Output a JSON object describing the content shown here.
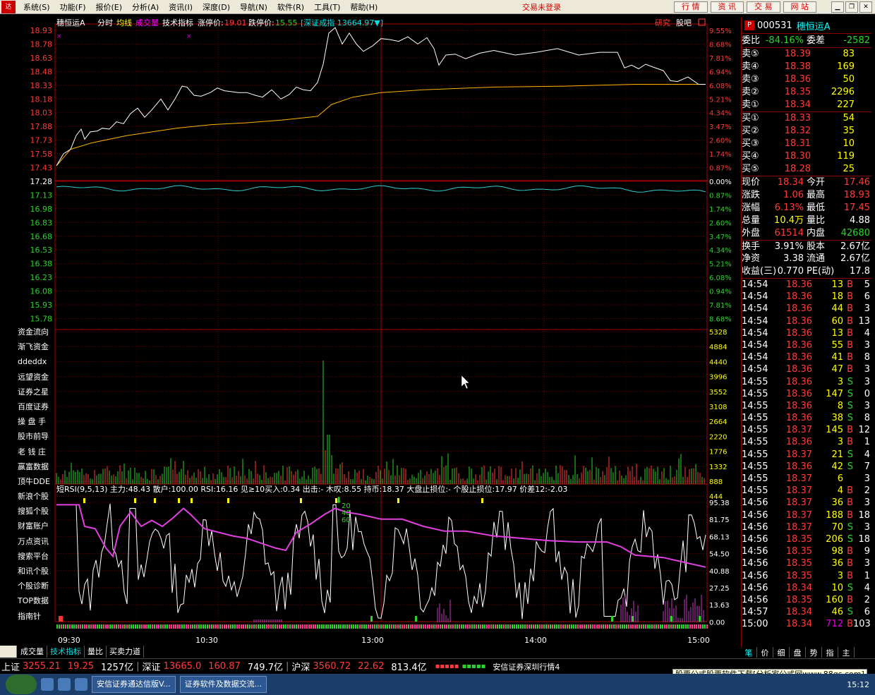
{
  "menubar": {
    "items": [
      "系统(S)",
      "功能(F)",
      "报价(E)",
      "分析(A)",
      "资讯(I)",
      "深度(D)",
      "导航(N)",
      "软件(R)",
      "工具(T)",
      "帮助(H)"
    ],
    "trade_status": "交易未登录",
    "tabs": [
      "行 情",
      "资 讯",
      "交 易",
      "网 站"
    ]
  },
  "chart_header": {
    "stock_name": "穗恒运A",
    "modes": [
      "分时",
      "均线",
      "成交量",
      "技术指标"
    ],
    "limit_up_label": "涨停价:",
    "limit_up": "19.01",
    "limit_down_label": "跌停价:",
    "limit_down": "15.55",
    "index_link": "[深证成指 13664.97▼]",
    "research": "研究",
    "forum": "股吧"
  },
  "price_axis": {
    "left": [
      "18.93",
      "18.78",
      "18.63",
      "18.48",
      "18.33",
      "18.18",
      "18.03",
      "17.88",
      "17.73",
      "17.58",
      "17.43",
      "17.28",
      "17.13",
      "16.98",
      "16.83",
      "16.68",
      "16.53",
      "16.38",
      "16.23",
      "16.08",
      "15.93",
      "15.78"
    ],
    "right": [
      "9.55%",
      "8.68%",
      "7.81%",
      "6.94%",
      "6.08%",
      "5.21%",
      "4.34%",
      "3.47%",
      "2.60%",
      "1.74%",
      "0.87%",
      "0.00%",
      "0.87%",
      "1.74%",
      "2.60%",
      "3.47%",
      "4.34%",
      "5.21%",
      "6.08%",
      "0.94%",
      "7.81%",
      "8.68%"
    ]
  },
  "volume_axis": [
    "5328",
    "4884",
    "4440",
    "3996",
    "3552",
    "3108",
    "2664",
    "2220",
    "1776",
    "1332",
    "888",
    "444"
  ],
  "indicator": {
    "legend": "短RSI(9,5,13)  主力:48.43  散户:100.00  RSI:16.16  见≥10买入:0.34  出击:-  木叹:8.55  持币:18.37  大盘止损位:-  个股止损位:17.97  价差12:-2.03",
    "axis": [
      "95.38",
      "81.75",
      "68.13",
      "54.50",
      "40.88",
      "27.25",
      "13.63",
      "0.00"
    ],
    "marks": [
      "20",
      "40",
      "60"
    ]
  },
  "time_axis": [
    "09:30",
    "10:30",
    "13:00",
    "14:00",
    "15:00"
  ],
  "sidenav": [
    "资金流向",
    "渐飞资金",
    "ddeddx",
    "远望资金",
    "证券之星",
    "百度证券",
    "操 盘 手",
    "股市前导",
    "老 钱 庄",
    "赢富数据",
    "顶牛DDE",
    "新浪个股",
    "搜狐个股",
    "财富账户",
    "万点资讯",
    "搜索平台",
    "和讯个股",
    "个股诊断",
    "TOP数据",
    "指南针"
  ],
  "bottom_tabs": [
    "成交量",
    "技术指标",
    "量比",
    "买卖力道"
  ],
  "quote": {
    "code": "000531",
    "name": "穗恒运A",
    "ratio_label": "委比",
    "ratio": "-84.16%",
    "diff_label": "委差",
    "diff": "-2582",
    "sell": [
      {
        "label": "卖⑤",
        "price": "18.39",
        "vol": "83"
      },
      {
        "label": "卖④",
        "price": "18.38",
        "vol": "169"
      },
      {
        "label": "卖③",
        "price": "18.36",
        "vol": "50"
      },
      {
        "label": "卖②",
        "price": "18.35",
        "vol": "2296"
      },
      {
        "label": "卖①",
        "price": "18.34",
        "vol": "227"
      }
    ],
    "buy": [
      {
        "label": "买①",
        "price": "18.33",
        "vol": "54"
      },
      {
        "label": "买②",
        "price": "18.32",
        "vol": "35"
      },
      {
        "label": "买③",
        "price": "18.31",
        "vol": "10"
      },
      {
        "label": "买④",
        "price": "18.30",
        "vol": "119"
      },
      {
        "label": "买⑤",
        "price": "18.28",
        "vol": "25"
      }
    ],
    "stats": [
      {
        "l1": "现价",
        "v1": "18.34",
        "c1": "red",
        "l2": "今开",
        "v2": "17.46",
        "c2": "red"
      },
      {
        "l1": "涨跌",
        "v1": "1.06",
        "c1": "red",
        "l2": "最高",
        "v2": "18.93",
        "c2": "red"
      },
      {
        "l1": "涨幅",
        "v1": "6.13%",
        "c1": "red",
        "l2": "最低",
        "v2": "17.45",
        "c2": "red"
      },
      {
        "l1": "总量",
        "v1": "10.4万",
        "c1": "yellow",
        "l2": "量比",
        "v2": "4.88",
        "c2": "white"
      },
      {
        "l1": "外盘",
        "v1": "61514",
        "c1": "red",
        "l2": "内盘",
        "v2": "42680",
        "c2": "green"
      },
      {
        "l1": "换手",
        "v1": "3.91%",
        "c1": "white",
        "l2": "股本",
        "v2": "2.67亿",
        "c2": "white"
      },
      {
        "l1": "净资",
        "v1": "3.38",
        "c1": "white",
        "l2": "流通",
        "v2": "2.67亿",
        "c2": "white"
      },
      {
        "l1": "收益(三)",
        "v1": "0.770",
        "c1": "white",
        "l2": "PE(动)",
        "v2": "17.8",
        "c2": "white"
      }
    ]
  },
  "ticks": [
    {
      "t": "14:54",
      "p": "18.36",
      "v": "13",
      "bs": "B",
      "n": "5"
    },
    {
      "t": "14:54",
      "p": "18.36",
      "v": "18",
      "bs": "B",
      "n": "6"
    },
    {
      "t": "14:54",
      "p": "18.36",
      "v": "44",
      "bs": "B",
      "n": "3"
    },
    {
      "t": "14:54",
      "p": "18.36",
      "v": "60",
      "bs": "B",
      "n": "13"
    },
    {
      "t": "14:54",
      "p": "18.36",
      "v": "13",
      "bs": "B",
      "n": "4"
    },
    {
      "t": "14:54",
      "p": "18.36",
      "v": "55",
      "bs": "B",
      "n": "3"
    },
    {
      "t": "14:54",
      "p": "18.36",
      "v": "41",
      "bs": "B",
      "n": "8"
    },
    {
      "t": "14:54",
      "p": "18.36",
      "v": "47",
      "bs": "B",
      "n": "3"
    },
    {
      "t": "14:55",
      "p": "18.36",
      "v": "3",
      "bs": "S",
      "n": "3"
    },
    {
      "t": "14:55",
      "p": "18.36",
      "v": "147",
      "bs": "S",
      "n": "0"
    },
    {
      "t": "14:55",
      "p": "18.36",
      "v": "8",
      "bs": "S",
      "n": "3"
    },
    {
      "t": "14:55",
      "p": "18.36",
      "v": "38",
      "bs": "S",
      "n": "8"
    },
    {
      "t": "14:55",
      "p": "18.37",
      "v": "145",
      "bs": "B",
      "n": "12"
    },
    {
      "t": "14:55",
      "p": "18.36",
      "v": "3",
      "bs": "B",
      "n": "1"
    },
    {
      "t": "14:55",
      "p": "18.37",
      "v": "21",
      "bs": "S",
      "n": "4"
    },
    {
      "t": "14:55",
      "p": "18.36",
      "v": "42",
      "bs": "S",
      "n": "7"
    },
    {
      "t": "14:55",
      "p": "18.37",
      "v": "6",
      "bs": "",
      "n": "3"
    },
    {
      "t": "14:55",
      "p": "18.37",
      "v": "4",
      "bs": "B",
      "n": "2"
    },
    {
      "t": "14:56",
      "p": "18.37",
      "v": "36",
      "bs": "B",
      "n": "3"
    },
    {
      "t": "14:56",
      "p": "18.37",
      "v": "188",
      "bs": "B",
      "n": "18"
    },
    {
      "t": "14:56",
      "p": "18.37",
      "v": "70",
      "bs": "S",
      "n": "3"
    },
    {
      "t": "14:56",
      "p": "18.35",
      "v": "206",
      "bs": "S",
      "n": "18"
    },
    {
      "t": "14:56",
      "p": "18.35",
      "v": "98",
      "bs": "B",
      "n": "9"
    },
    {
      "t": "14:56",
      "p": "18.35",
      "v": "36",
      "bs": "B",
      "n": "3"
    },
    {
      "t": "14:56",
      "p": "18.35",
      "v": "3",
      "bs": "B",
      "n": "1"
    },
    {
      "t": "14:56",
      "p": "18.34",
      "v": "10",
      "bs": "S",
      "n": "4"
    },
    {
      "t": "14:56",
      "p": "18.35",
      "v": "160",
      "bs": "B",
      "n": "2"
    },
    {
      "t": "14:57",
      "p": "18.34",
      "v": "46",
      "bs": "S",
      "n": "6"
    },
    {
      "t": "15:00",
      "p": "18.34",
      "v": "712",
      "bs": "B",
      "n": "103"
    }
  ],
  "right_tabs": [
    "笔",
    "价",
    "细",
    "盘",
    "势",
    "指",
    "主"
  ],
  "index_bar": {
    "sh_name": "上证",
    "sh_val": "3255.21",
    "sh_chg": "19.25",
    "sh_amt": "1257亿",
    "sz_name": "深证",
    "sz_val": "13665.0",
    "sz_chg": "160.87",
    "sz_amt": "749.7亿",
    "hs_name": "沪深",
    "hs_val": "3560.72",
    "hs_chg": "22.62",
    "hs_amt": "813.4亿",
    "broker": "安信证券深圳行情4",
    "ad": "股票公式股票软件下载[分析家公式网www.88gs.com]"
  },
  "taskbar": {
    "btn1": "安信证券通达信版V...",
    "btn2": "证券软件及数据交流...",
    "clock": "15:12"
  }
}
